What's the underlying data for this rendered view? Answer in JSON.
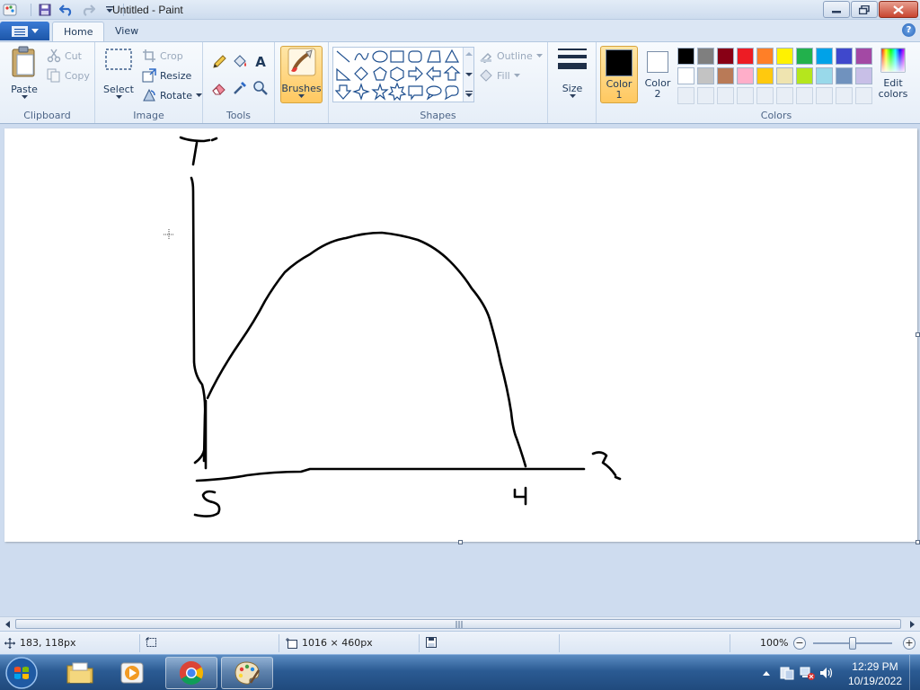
{
  "window": {
    "title": "Untitled - Paint"
  },
  "tabs": {
    "home": "Home",
    "view": "View"
  },
  "clipboard": {
    "paste": "Paste",
    "cut": "Cut",
    "copy": "Copy",
    "label": "Clipboard"
  },
  "image": {
    "select": "Select",
    "crop": "Crop",
    "resize": "Resize",
    "rotate": "Rotate",
    "label": "Image"
  },
  "tools": {
    "label": "Tools",
    "text_glyph": "A"
  },
  "brushes": {
    "label": "Brushes"
  },
  "shapes": {
    "label": "Shapes",
    "outline": "Outline",
    "fill": "Fill"
  },
  "size": {
    "label": "Size"
  },
  "colors": {
    "label": "Colors",
    "color1_line1": "Color",
    "color1_line2": "1",
    "color2_line1": "Color",
    "color2_line2": "2",
    "color1_value": "#000000",
    "color2_value": "#ffffff",
    "edit_line1": "Edit",
    "edit_line2": "colors",
    "palette_row1": [
      "#000000",
      "#7f7f7f",
      "#880015",
      "#ed1c24",
      "#ff7f27",
      "#fff200",
      "#22b14c",
      "#00a2e8",
      "#3f48cc",
      "#a349a4"
    ],
    "palette_row2": [
      "#ffffff",
      "#c3c3c3",
      "#b97a57",
      "#ffaec9",
      "#ffc90e",
      "#efe4b0",
      "#b5e61d",
      "#99d9ea",
      "#7092be",
      "#c8bfe7"
    ]
  },
  "status": {
    "cursor_pos": "183, 118px",
    "canvas_size": "1016 × 460px",
    "zoom": "100%"
  },
  "taskbar": {
    "time": "12:29 PM",
    "date": "10/19/2022"
  }
}
